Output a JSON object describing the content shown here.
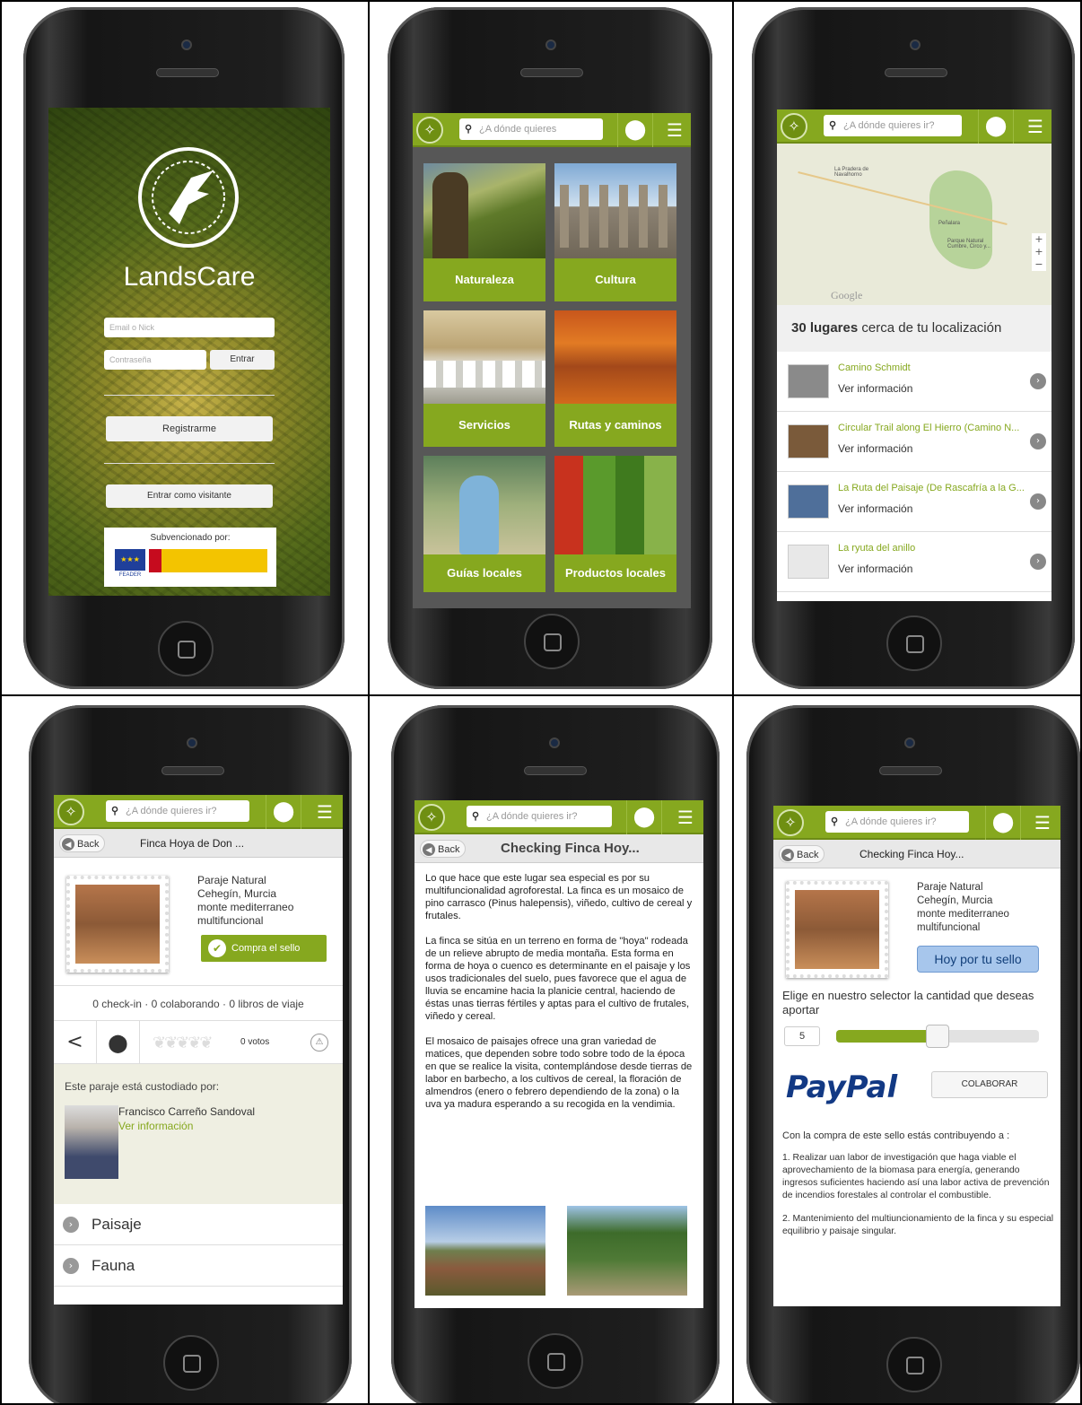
{
  "common": {
    "search_placeholder": "¿A dónde quieres ir?",
    "search_placeholder_short": "¿A dónde quieres",
    "search_icon": "magnifier-icon",
    "location_icon": "map-pin-icon",
    "menu_icon": "hamburger-icon",
    "back_label": "Back",
    "accent_color": "#86a81f"
  },
  "login": {
    "app_name": "LandsCare",
    "email_placeholder": "Email o Nick",
    "password_placeholder": "Contraseña",
    "enter_button": "Entrar",
    "register_button": "Registrarme",
    "guest_button": "Entrar como visitante",
    "subsidy_label": "Subvencionado por:",
    "feader_label": "FEADER"
  },
  "categories": {
    "items": [
      {
        "label": "Naturaleza"
      },
      {
        "label": "Cultura"
      },
      {
        "label": "Servicios"
      },
      {
        "label": "Rutas y caminos"
      },
      {
        "label": "Guías locales"
      },
      {
        "label": "Productos locales"
      }
    ]
  },
  "nearby": {
    "map_labels": [
      "La Pradera de Navalhorno",
      "Parque Natural Cumbre, Circo y...",
      "Peñalara"
    ],
    "map_brand": "Google",
    "count_bold": "30 lugares",
    "count_rest": " cerca de tu localización",
    "places": [
      {
        "name": "Camino Schmidt",
        "action": "Ver información"
      },
      {
        "name": "Circular Trail along El Hierro (Camino N...",
        "action": "Ver información"
      },
      {
        "name": "La Ruta del Paisaje (De Rascafría a la G...",
        "action": "Ver información"
      },
      {
        "name": "La ryuta del anillo",
        "action": "Ver información"
      }
    ]
  },
  "detail": {
    "title": "Finca Hoya de Don ...",
    "info_lines": [
      "Paraje Natural",
      "Cehegín, Murcia",
      "monte mediterraneo",
      "multifuncional"
    ],
    "buy_button": "Compra el sello",
    "stats": "0 check-in · 0 colaborando · 0 libros de viaje",
    "votes": "0 votos",
    "guardian_label": "Este paraje está custodiado por:",
    "guardian_name": "Francisco Carreño Sandoval",
    "guardian_link": "Ver información",
    "sections": [
      "Paisaje",
      "Fauna"
    ]
  },
  "checking": {
    "title": "Checking Finca Hoy...",
    "paragraphs": [
      "Lo que hace que este lugar sea especial es por su multifuncionalidad agroforestal. La finca es un mosaico de pino carrasco (Pinus halepensis), viñedo, cultivo de cereal y frutales.",
      "La finca se sitúa en un terreno en forma de \"hoya\" rodeada de un relieve abrupto de media montaña. Esta forma en forma de hoya o cuenco es determinante en el paisaje y los usos tradicionales del suelo, pues favorece que el agua de lluvia se encamine hacia la planicie central, haciendo de éstas unas tierras fértiles y aptas para el cultivo de frutales, viñedo y cereal.",
      "El mosaico de paisajes ofrece una gran variedad de matices, que dependen sobre todo sobre todo de la época en que se realice la visita, contemplándose desde tierras de labor en barbecho, a los cultivos de cereal, la floración de almendros (enero o febrero dependiendo de la zona) o la uva ya madura esperando a su recogida en la vendimia."
    ]
  },
  "donate": {
    "title": "Checking Finca Hoy...",
    "info_lines": [
      "Paraje Natural",
      "Cehegín, Murcia",
      "monte mediterraneo",
      "multifuncional"
    ],
    "buy_button": "Hoy por tu sello",
    "selector_label": "Elige en nuestro selector la cantidad que deseas aportar",
    "amount": "5",
    "slider_level": 0.5,
    "paypal_brand": "PayPal",
    "collaborate_button": "COLABORAR",
    "contrib_intro": "Con  la compra de este sello estás contribuyendo a :",
    "contrib_items": [
      "1. Realizar uan labor de investigación que haga viable el aprovechamiento de la biomasa para energía, generando ingresos suficientes haciendo así una labor activa de prevención de incendios forestales al controlar el combustible.",
      "2. Mantenimiento del multiuncionamiento de la finca y su especial equilibrio y paisaje singular."
    ]
  }
}
